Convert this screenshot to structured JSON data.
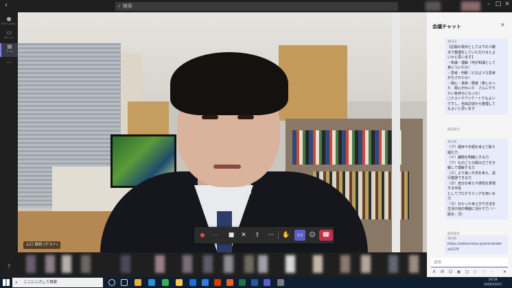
{
  "app": {
    "search_placeholder": "検索"
  },
  "rail": {
    "items": [
      {
        "label": "アクティビティ",
        "icon": "bell-icon"
      },
      {
        "label": "チャット",
        "icon": "chat-icon"
      },
      {
        "label": "チーム",
        "icon": "teams-icon"
      }
    ]
  },
  "video": {
    "participant_label": "山口 敏和 (ゲスト)"
  },
  "controls": {
    "timer": "--:--"
  },
  "chat": {
    "title": "会議チャット",
    "messages": [
      {
        "time": "16:23",
        "lines": [
          "【記録の視点として以下の３観",
          "点で整理をしていただけるとよ",
          "いかと思います】",
          "・知識・理解（何が知識として",
          "身についたか）",
          "・思考・判断（どのような思考",
          "がなされたか）",
          "・関心・意欲・態度（楽しかっ",
          "た　関心がわいた　さんにやり",
          "たい気持ちになった）",
          "□テストやアンケートでもよい",
          "ですし、自由記述から整理して",
          "もよいと思います"
        ],
        "status": "既読表示"
      },
      {
        "time": "16:30",
        "lines": [
          "（ア）順序や手順を考えて取り",
          "組む力",
          "（イ）課題を明確にする力",
          "（ウ）ものごとの組み立てを分",
          "解して理解する力",
          "（エ）より良い方法を考え、試",
          "行錯誤できる力",
          "（オ）自分の考えや感性を表現",
          "する手段",
          "としてプログラミングを用いる",
          "力",
          "（カ）分かった考え方や方法を",
          "生活の他の場面に活かす力（一",
          "般化：汎）"
        ],
        "status": "既読表示"
      },
      {
        "time": "16:42",
        "lines": [
          "https://edtechzine.jp/article/det",
          "ail/225"
        ],
        "status": ""
      }
    ],
    "compose_placeholder": "返信"
  },
  "taskbar": {
    "search_placeholder": "ここに入力して検索",
    "time": "16:58",
    "date": "2020/10/15"
  },
  "colors": {
    "accent": "#5b5fc7",
    "hangup": "#c4314b",
    "chat_bubble": "#e8ebfa"
  }
}
